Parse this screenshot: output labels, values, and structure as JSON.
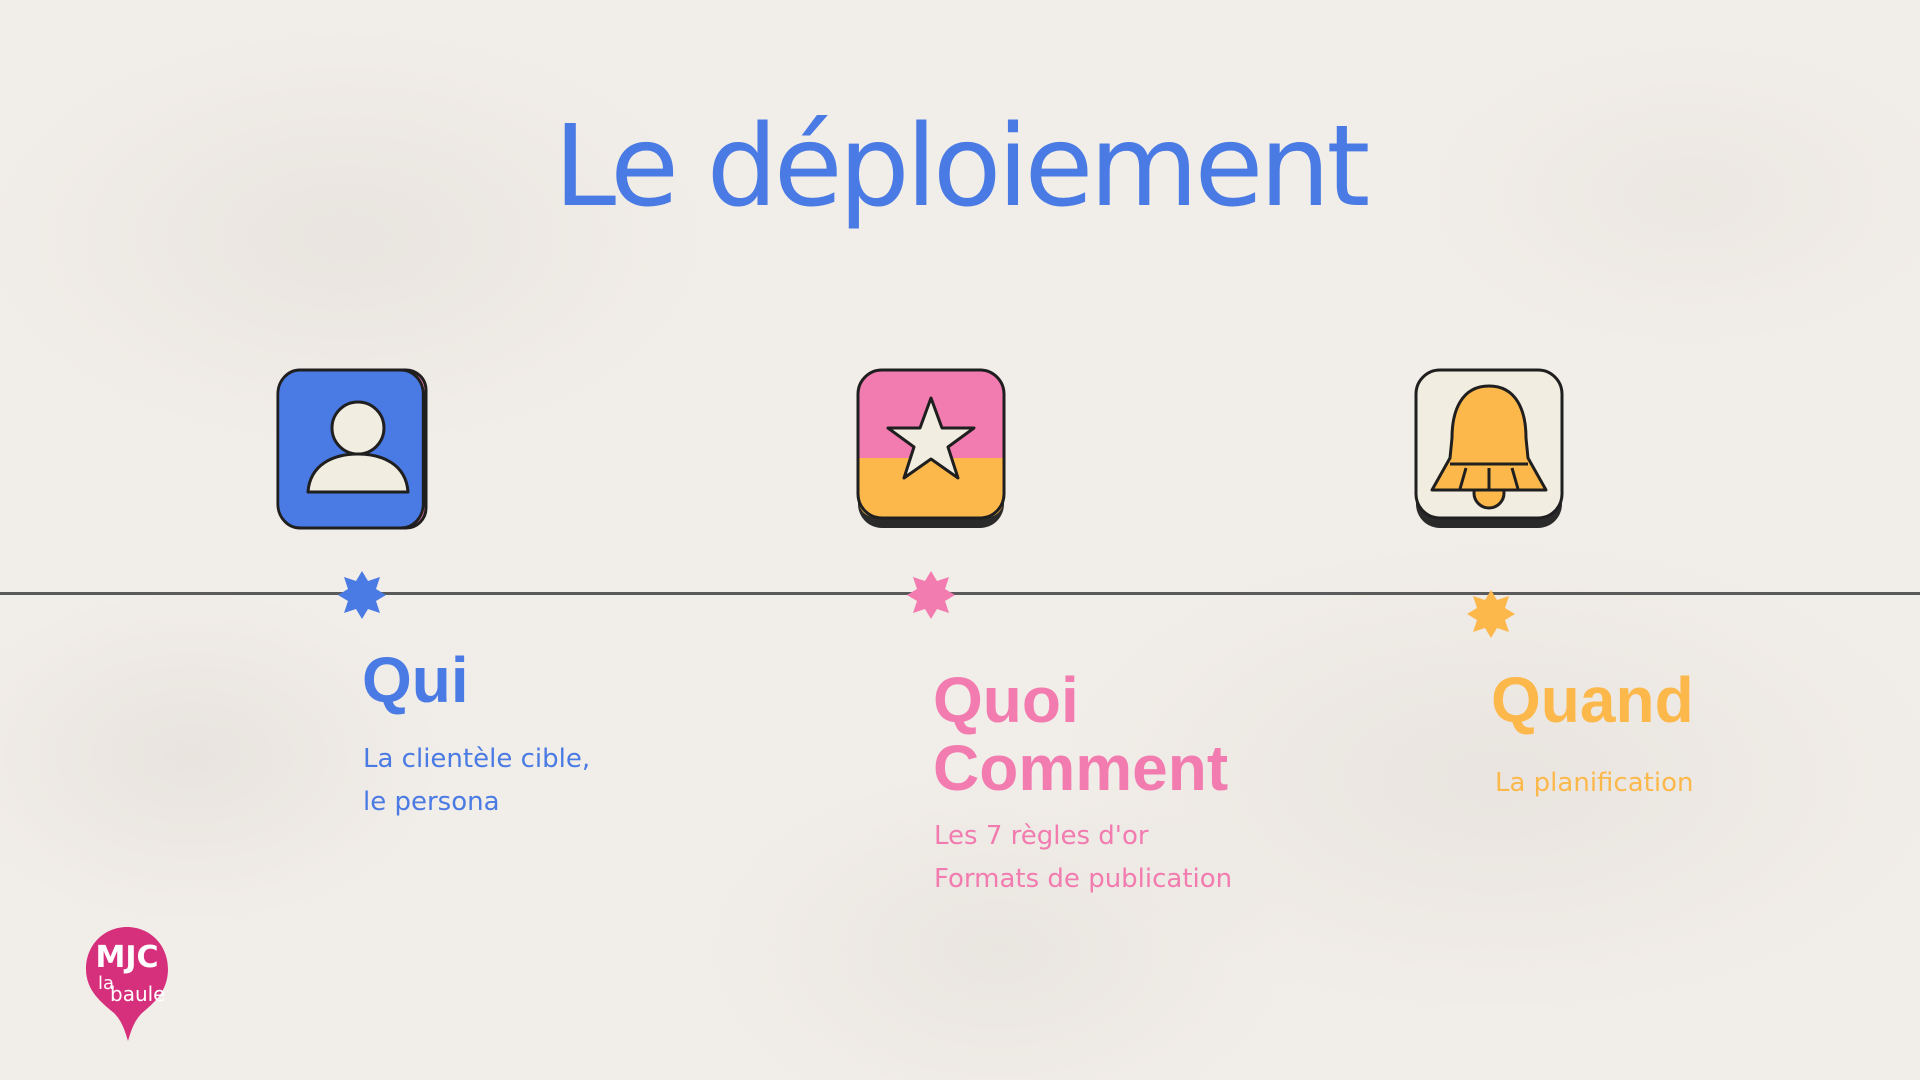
{
  "slide": {
    "title": "Le déploiement"
  },
  "columns": [
    {
      "heading": "Qui",
      "description": [
        "La clientèle cible,",
        "le persona"
      ],
      "icon": "contact-book-icon",
      "color": "#4a7ae3"
    },
    {
      "heading_lines": [
        "Quoi",
        "Comment"
      ],
      "description": [
        "Les 7 règles d'or",
        "Formats de publication"
      ],
      "icon": "star-icon",
      "color": "#f27bb0"
    },
    {
      "heading": "Quand",
      "description": [
        "La planification"
      ],
      "icon": "bell-icon",
      "color": "#fdb84c"
    }
  ],
  "logo": {
    "line1": "MJC",
    "line2": "la",
    "line3": "baule",
    "color": "#d62f7c"
  }
}
